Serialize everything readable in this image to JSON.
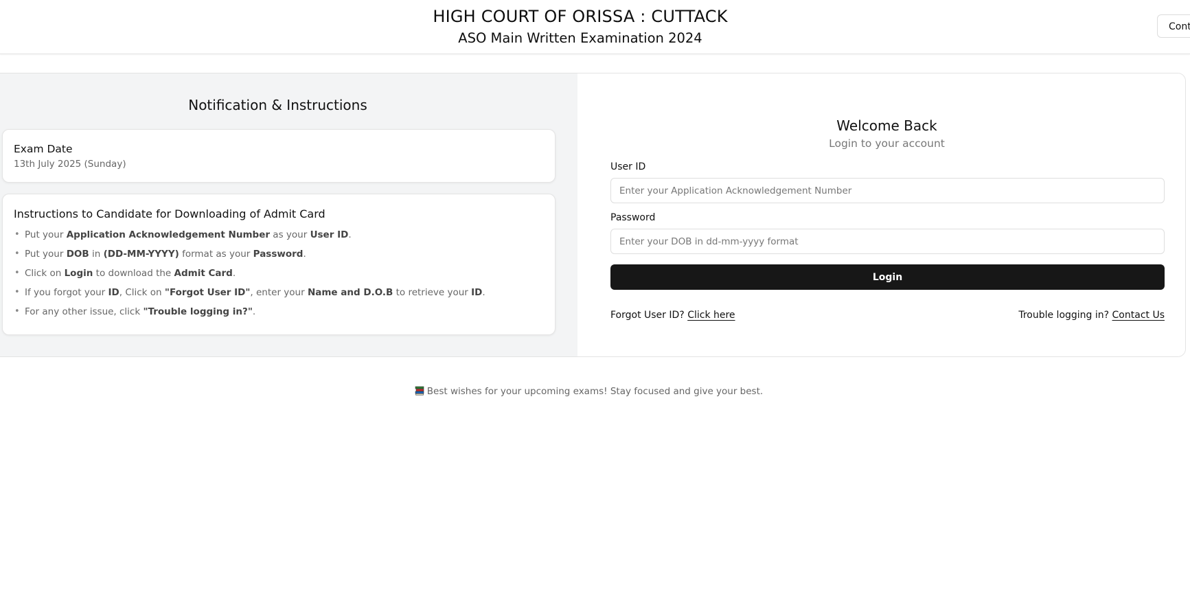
{
  "header": {
    "title": "HIGH COURT OF ORISSA : CUTTACK",
    "subtitle": "ASO Main Written Examination 2024",
    "contact_button": "Contact Us"
  },
  "notification": {
    "heading": "Notification & Instructions",
    "exam_date_label": "Exam Date",
    "exam_date_value": "13th July 2025 (Sunday)",
    "instructions_title": "Instructions to Candidate for Downloading of Admit Card",
    "instructions": [
      {
        "segments": [
          {
            "t": "Put your ",
            "b": false
          },
          {
            "t": "Application Acknowledgement Number",
            "b": true
          },
          {
            "t": " as your ",
            "b": false
          },
          {
            "t": "User ID",
            "b": true
          },
          {
            "t": ".",
            "b": false
          }
        ]
      },
      {
        "segments": [
          {
            "t": "Put your ",
            "b": false
          },
          {
            "t": "DOB",
            "b": true
          },
          {
            "t": " in ",
            "b": false
          },
          {
            "t": "(DD-MM-YYYY)",
            "b": true
          },
          {
            "t": " format as your ",
            "b": false
          },
          {
            "t": "Password",
            "b": true
          },
          {
            "t": ".",
            "b": false
          }
        ]
      },
      {
        "segments": [
          {
            "t": "Click on ",
            "b": false
          },
          {
            "t": "Login",
            "b": true
          },
          {
            "t": " to download the ",
            "b": false
          },
          {
            "t": "Admit Card",
            "b": true
          },
          {
            "t": ".",
            "b": false
          }
        ]
      },
      {
        "segments": [
          {
            "t": "If you forgot your ",
            "b": false
          },
          {
            "t": "ID",
            "b": true
          },
          {
            "t": ", Click on ",
            "b": false
          },
          {
            "t": "\"Forgot User ID\"",
            "b": true
          },
          {
            "t": ", enter your ",
            "b": false
          },
          {
            "t": "Name and D.O.B",
            "b": true
          },
          {
            "t": " to retrieve your ",
            "b": false
          },
          {
            "t": "ID",
            "b": true
          },
          {
            "t": ".",
            "b": false
          }
        ]
      },
      {
        "segments": [
          {
            "t": "For any other issue, click ",
            "b": false
          },
          {
            "t": "\"Trouble logging in?\"",
            "b": true
          },
          {
            "t": ".",
            "b": false
          }
        ]
      }
    ]
  },
  "login": {
    "title": "Welcome Back",
    "subtitle": "Login to your account",
    "user_id_label": "User ID",
    "user_id_placeholder": "Enter your Application Acknowledgement Number",
    "user_id_value": "",
    "password_label": "Password",
    "password_placeholder": "Enter your DOB in dd-mm-yyyy format",
    "password_value": "",
    "login_button": "Login",
    "forgot_text": "Forgot User ID?",
    "forgot_link": "Click here",
    "trouble_text": "Trouble logging in?",
    "trouble_link": "Contact Us"
  },
  "footer": {
    "message": "Best wishes for your upcoming exams! Stay focused and give your best.",
    "icon": "books-icon"
  },
  "colors": {
    "primary_button": "#171717",
    "left_panel_bg": "#f3f4f5",
    "muted_text": "#666666"
  }
}
